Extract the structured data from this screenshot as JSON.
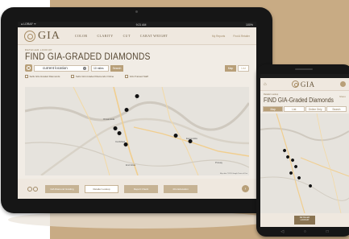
{
  "tablet": {
    "status_left": "● LORAF ᯤ",
    "status_center": "9:21 AM",
    "status_right": "100%",
    "logo": "GIA",
    "nav": [
      "COLOR",
      "CLARITY",
      "CUT",
      "CARAT WEIGHT"
    ],
    "util_links": [
      "My Reports",
      "Find A Retailer"
    ],
    "breadcrumb": "RETAILER LOOKUP",
    "title": "FIND GIA-GRADED DIAMONDS",
    "location_value": "current location",
    "radius_value": "10 miles",
    "search_label": "Search",
    "view_map": "Map",
    "view_list": "List",
    "filters": [
      "Sells GIA-Graded Diamonds",
      "Sells GIA-Graded Diamonds Online",
      "GIA-Trained Staff"
    ],
    "map_labels": [
      "Oceanside",
      "Escondido",
      "Carlsbad",
      "Encinitas",
      "Poway"
    ],
    "map_credit": "Map data ©2015 Google  Terms of Use",
    "footer_buttons": [
      "GIA Diamond Grading",
      "Retailer Lookup",
      "Report Check",
      "4Cs Education"
    ],
    "footer_arrow": "›"
  },
  "phone": {
    "logo": "GIA",
    "breadcrumb": "Retailer Lookup",
    "title": "FIND GIA-Graded Diamonds",
    "share": "Share",
    "tabs": [
      "Map",
      "List",
      "Online Only",
      "Search"
    ],
    "footer_btn_line1": "RETAILER",
    "footer_btn_line2": "LOOKUP",
    "nav_back": "◁",
    "nav_home": "○",
    "nav_recent": "□"
  },
  "colors": {
    "beige": "#c8ab84",
    "gold_accent": "#b89f78",
    "dark_brown": "#574833",
    "device": "#161616"
  },
  "icons": [
    "location-icon",
    "clear-icon",
    "pin-icon",
    "diamond-rings-icon",
    "next-arrow-icon",
    "home-icon",
    "menu-icon"
  ]
}
